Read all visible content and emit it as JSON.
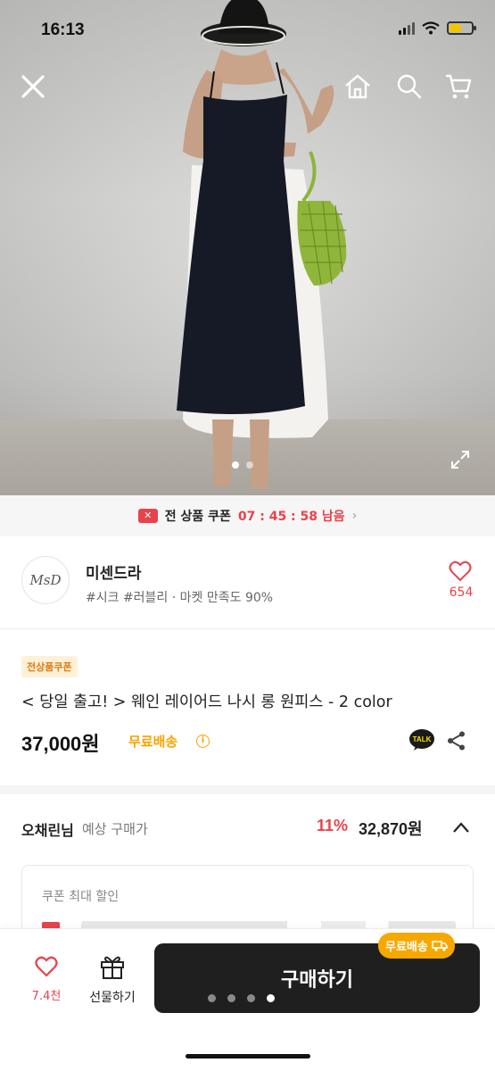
{
  "status_bar": {
    "time": "16:13"
  },
  "hero": {
    "slide_index": 1,
    "slide_count": 2
  },
  "coupon_strip": {
    "label": "전 상품 쿠폰",
    "timer": "07 : 45 : 58 남음",
    "chevron": "›",
    "icon": "coupon-icon"
  },
  "seller": {
    "name": "미센드라",
    "meta": "#시크 #러블리 · 마켓 만족도 90%",
    "logo_text": "MsD",
    "like_count": "654"
  },
  "product": {
    "badge": "전상품쿠폰",
    "title": "< 당일 출고! >  웨인 레이어드 나시 롱 원피스 - 2 color",
    "price": "37,000원",
    "free_shipping": "무료배송",
    "info_symbol": "i",
    "talk_label": "TALK"
  },
  "expected_price": {
    "user": "오채린님",
    "label": "예상 구매가",
    "discount": "11%",
    "final_price": "32,870원"
  },
  "coupon_box": {
    "title": "쿠폰 최대 할인"
  },
  "bottom_bar": {
    "like_count": "7.4천",
    "gift_label": "선물하기",
    "buy_label": "구매하기",
    "shipping_badge": "무료배송",
    "page_dot_count": 4,
    "page_dot_active": 4
  },
  "colors": {
    "accent_red": "#e8424d",
    "accent_orange": "#f5a400",
    "buy_button": "#1f1f1f",
    "battery": "#f5c400"
  }
}
